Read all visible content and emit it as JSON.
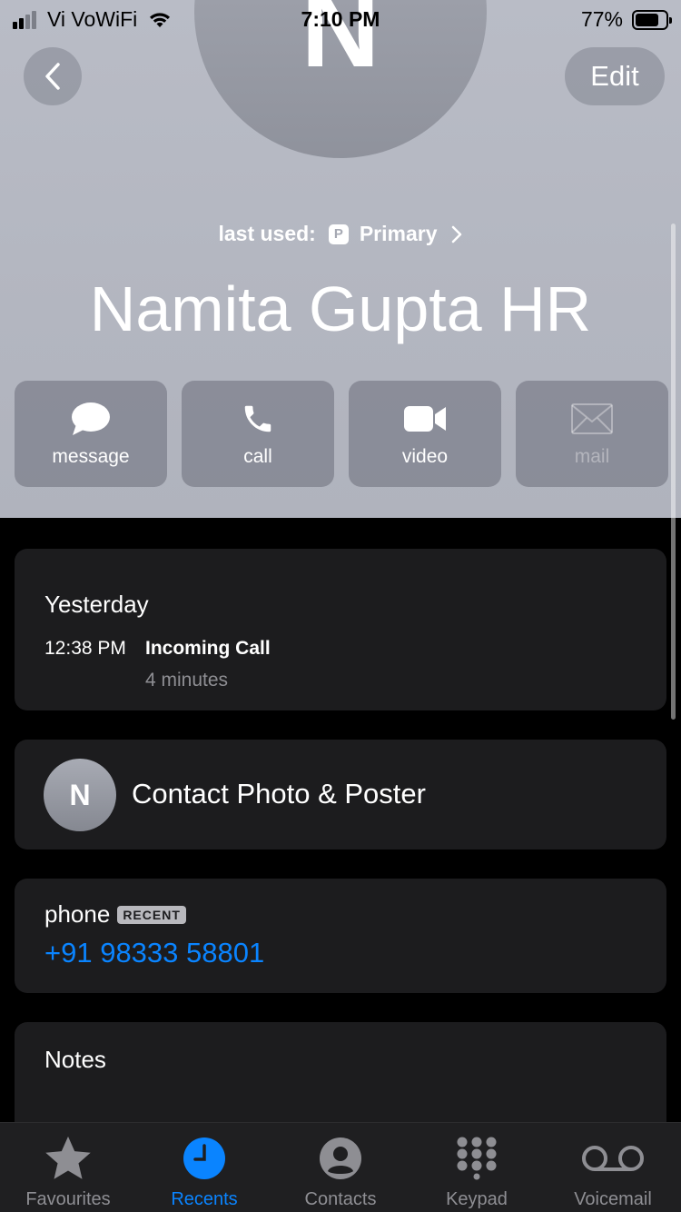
{
  "status_bar": {
    "carrier": "Vi VoWiFi",
    "time": "7:10 PM",
    "battery_percent": "77%",
    "battery_level": 0.77
  },
  "header": {
    "avatar_letter": "N",
    "back_icon": "chevron-left-icon",
    "edit_label": "Edit",
    "last_used_label": "last used:",
    "last_used_badge": "P",
    "last_used_line": "Primary",
    "contact_name": "Namita Gupta HR"
  },
  "actions": [
    {
      "label": "message",
      "icon": "message-bubble-icon",
      "enabled": true
    },
    {
      "label": "call",
      "icon": "phone-icon",
      "enabled": true
    },
    {
      "label": "video",
      "icon": "video-camera-icon",
      "enabled": true
    },
    {
      "label": "mail",
      "icon": "envelope-icon",
      "enabled": false
    }
  ],
  "recent_call": {
    "day": "Yesterday",
    "time": "12:38 PM",
    "type": "Incoming Call",
    "duration": "4 minutes"
  },
  "contact_photo": {
    "avatar_letter": "N",
    "label": "Contact Photo & Poster"
  },
  "phone": {
    "label": "phone",
    "badge": "RECENT",
    "number": "+91 98333 58801"
  },
  "notes": {
    "label": "Notes"
  },
  "tabbar": {
    "tabs": [
      {
        "label": "Favourites",
        "icon": "star-icon",
        "active": false
      },
      {
        "label": "Recents",
        "icon": "clock-icon",
        "active": true
      },
      {
        "label": "Contacts",
        "icon": "person-circle-icon",
        "active": false
      },
      {
        "label": "Keypad",
        "icon": "keypad-icon",
        "active": false
      },
      {
        "label": "Voicemail",
        "icon": "voicemail-icon",
        "active": false
      }
    ]
  },
  "colors": {
    "accent": "#0a84ff",
    "card_bg": "#1c1c1e",
    "header_bg": "#b5b8c2"
  }
}
